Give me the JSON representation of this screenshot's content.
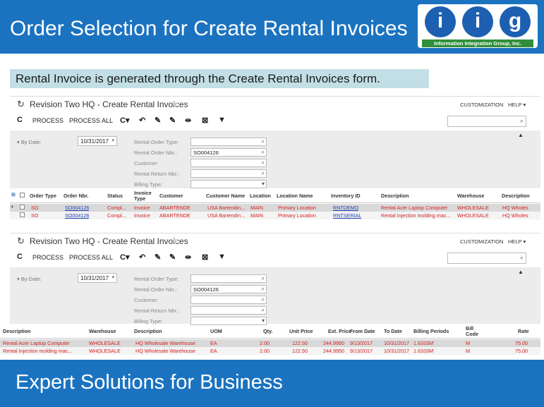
{
  "slide": {
    "title": "Order Selection for Create Rental Invoices",
    "info": "Rental Invoice is generated through the Create Rental Invoices form.",
    "footer": "Expert Solutions for Business"
  },
  "logo": {
    "letters": [
      "i",
      "i",
      "g"
    ],
    "company": "Information Integration Group, Inc."
  },
  "screen": {
    "breadcrumb": "Revision Two HQ",
    "separator": "-",
    "form_title": "Create Rental Invoices",
    "customization": "CUSTOMIZATION",
    "help": "HELP ▾",
    "toolbar": {
      "process": "PROCESS",
      "process_all": "PROCESS ALL"
    },
    "filter": {
      "by_date_label": "▾ By Date:",
      "date_value": "10/31/2017",
      "rental_order_type_label": "Rental Order Type:",
      "rental_order_nbr_label": "Rental Order Nbr.:",
      "rental_order_nbr_value": "SO004126",
      "customer_label": "Customer:",
      "rental_return_nbr_label": "Rental Return Nbr.:",
      "billing_type_label": "Billing Type:"
    }
  },
  "grid1": {
    "headers": {
      "order_type": "Order Type",
      "order_nbr": "Order Nbr.",
      "status": "Status",
      "invoice_type_1": "Invoice",
      "invoice_type_2": "Type",
      "customer": "Customer",
      "customer_name": "Customer Name",
      "location": "Location",
      "location_name": "Location Name",
      "inventory_id": "Inventory ID",
      "description": "Description",
      "warehouse": "Warehouse",
      "description2": "Description"
    },
    "rows": [
      {
        "order_type": "SO",
        "order_nbr": "SO004126",
        "status": "Compl...",
        "invoice_type": "Invoice",
        "customer": "ABARTENDE",
        "customer_name": "USA Bartendin...",
        "location": "MAIN",
        "location_name": "Primary Location",
        "inventory_id": "RNTDEMO",
        "description": "Rental Acer Laptop Computer",
        "warehouse": "WHOLESALE",
        "description2": "HQ Wholes"
      },
      {
        "order_type": "SO",
        "order_nbr": "SO004126",
        "status": "Compl...",
        "invoice_type": "Invoice",
        "customer": "ABARTENDE",
        "customer_name": "USA Bartendin...",
        "location": "MAIN",
        "location_name": "Primary Location",
        "inventory_id": "RNTSERIAL",
        "description": "Rental Injection molding mac...",
        "warehouse": "WHOLESALE",
        "description2": "HQ Wholes"
      }
    ]
  },
  "grid2": {
    "headers": {
      "description": "Description",
      "warehouse": "Warehouse",
      "description2": "Description",
      "uom": "UOM",
      "qty": "Qty.",
      "unit_price": "Unit Price",
      "ext_price": "Ext. Price",
      "from_date": "From Date",
      "to_date": "To Date",
      "billing_periods": "Billing Periods",
      "bill_code_1": "Bill",
      "bill_code_2": "Code",
      "rate": "Rate"
    },
    "rows": [
      {
        "description": "Rental Acer Laptop Computer",
        "warehouse": "WHOLESALE",
        "description2": "HQ Wholesale Warehouse",
        "uom": "EA",
        "qty": "2.00",
        "unit_price": "122.50",
        "ext_price": "244.9950",
        "from_date": "9/13/2017",
        "to_date": "10/31/2017",
        "billing_periods": "1.6333M'",
        "bill_code": "M",
        "rate": "75.00"
      },
      {
        "description": "Rental Injection molding mac...",
        "warehouse": "WHOLESALE",
        "description2": "HQ Wholesale Warehouse",
        "uom": "EA",
        "qty": "2.00",
        "unit_price": "122.50",
        "ext_price": "244.9950",
        "from_date": "9/13/2017",
        "to_date": "10/31/2017",
        "billing_periods": "1.6333M'",
        "bill_code": "M",
        "rate": "75.00"
      }
    ]
  }
}
